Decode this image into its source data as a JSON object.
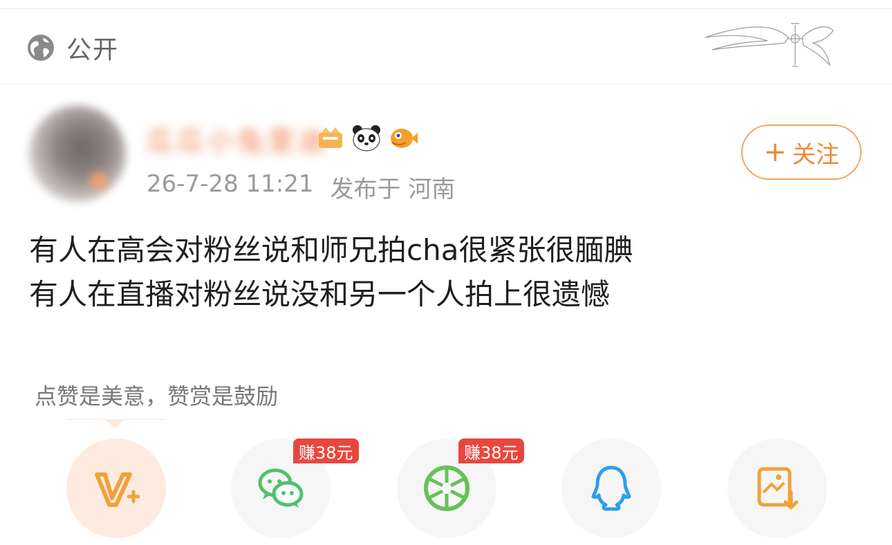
{
  "top_bar": {
    "visibility_label": "公开",
    "visibility_icon": "globe-icon",
    "decoration_icon": "winged-cross-icon"
  },
  "post": {
    "avatar_icon": "user-avatar",
    "username": "瓜瓜小兔里迪",
    "badges": [
      "crown-badge-icon",
      "panda-icon",
      "pufferfish-icon"
    ],
    "timestamp": "26-7-28 11:21",
    "location": "发布于 河南",
    "follow_label": "关注",
    "follow_icon": "plus-icon",
    "content_lines": [
      "有人在高会对粉丝说和师兄拍cha很紧张很腼腆",
      "有人在直播对粉丝说没和另一个人拍上很遗憾"
    ]
  },
  "tip": {
    "text": "点赞是美意，赞赏是鼓励"
  },
  "share": {
    "items": [
      {
        "icon": "v-plus-icon"
      },
      {
        "icon": "wechat-icon",
        "tag": "赚38元"
      },
      {
        "icon": "moments-icon",
        "tag": "赚38元"
      },
      {
        "icon": "qq-icon"
      },
      {
        "icon": "save-image-icon"
      }
    ]
  },
  "colors": {
    "accent": "#f1a460",
    "tag_red": "#e8473f",
    "wechat_green": "#4fc26b",
    "qq_blue": "#2e9ee8",
    "save_orange": "#f0a23a"
  }
}
